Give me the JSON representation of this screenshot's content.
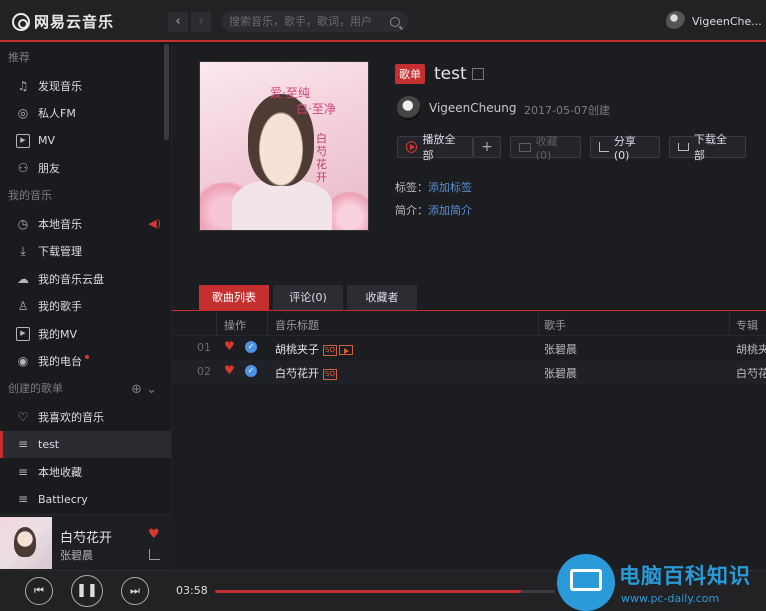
{
  "app": {
    "logo_text": "网易云音乐",
    "accent_color": "#c62f2f"
  },
  "topbar": {
    "search_placeholder": "搜索音乐，歌手，歌词，用户",
    "user_name": "VigeenChe..."
  },
  "sidebar": {
    "section_recommend": "推荐",
    "recommend_items": [
      {
        "label": "发现音乐",
        "icon": "music-note-icon"
      },
      {
        "label": "私人FM",
        "icon": "radio-icon"
      },
      {
        "label": "MV",
        "icon": "video-icon"
      },
      {
        "label": "朋友",
        "icon": "friends-icon"
      }
    ],
    "section_my_music": "我的音乐",
    "my_music_items": [
      {
        "label": "本地音乐",
        "icon": "clock-icon"
      },
      {
        "label": "下载管理",
        "icon": "download-icon"
      },
      {
        "label": "我的音乐云盘",
        "icon": "cloud-icon"
      },
      {
        "label": "我的歌手",
        "icon": "user-icon"
      },
      {
        "label": "我的MV",
        "icon": "video-icon"
      },
      {
        "label": "我的电台",
        "icon": "broadcast-icon"
      }
    ],
    "section_created": "创建的歌单",
    "created_items": [
      {
        "label": "我喜欢的音乐",
        "icon": "heart-outline-icon"
      },
      {
        "label": "test",
        "icon": "playlist-icon"
      },
      {
        "label": "本地收藏",
        "icon": "playlist-icon"
      },
      {
        "label": "Battlecry",
        "icon": "playlist-icon"
      }
    ]
  },
  "mini_player": {
    "title": "白芍花开",
    "artist": "张碧晨"
  },
  "player": {
    "current_time": "03:58",
    "progress": 0.9
  },
  "playlist": {
    "badge": "歌单",
    "title": "test",
    "creator": "VigeenCheung",
    "created": "2017-05-07创建",
    "cover_text_1": "爱·至纯",
    "cover_text_2": "白·至净",
    "cover_text_3": "白芍花开",
    "buttons": {
      "play_all": "播放全部",
      "add": "+",
      "collect": "收藏(0)",
      "share": "分享(0)",
      "download_all": "下载全部"
    },
    "tags_label": "标签：",
    "tags_link": "添加标签",
    "intro_label": "简介：",
    "intro_link": "添加简介"
  },
  "tabs": [
    "歌曲列表",
    "评论(0)",
    "收藏者"
  ],
  "table": {
    "headers": [
      "操作",
      "音乐标题",
      "歌手",
      "专辑"
    ],
    "rows": [
      {
        "index": "01",
        "title": "胡桃夹子",
        "quality": "SQ",
        "has_mv": true,
        "artist": "张碧晨",
        "album": "胡桃夹"
      },
      {
        "index": "02",
        "title": "白芍花开",
        "quality": "SQ",
        "has_mv": false,
        "artist": "张碧晨",
        "album": "白芍花"
      }
    ]
  },
  "watermark": {
    "title": "电脑百科知识",
    "url": "www.pc-daily.com"
  }
}
